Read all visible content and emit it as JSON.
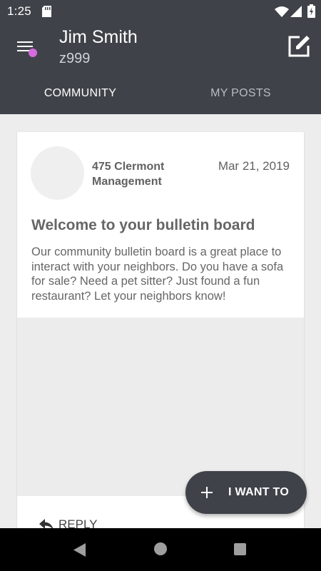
{
  "status_bar": {
    "time": "1:25"
  },
  "header": {
    "user_name": "Jim Smith",
    "user_id": "z999",
    "notification_color": "#d66be0"
  },
  "tabs": [
    {
      "label": "COMMUNITY",
      "selected": true
    },
    {
      "label": "MY POSTS",
      "selected": false
    }
  ],
  "post": {
    "author": "475 Clermont Management",
    "date": "Mar 21, 2019",
    "title": "Welcome to your bulletin board",
    "body": "Our community bulletin board is a great place to interact with your neighbors.  Do you have a sofa for sale?  Need a pet sitter?  Just found a fun restaurant?  Let your neighbors know!",
    "reply_label": "REPLY"
  },
  "fab": {
    "label": "I WANT TO"
  },
  "colors": {
    "primary": "#3f4349",
    "background": "#ededed",
    "card": "#ffffff"
  }
}
